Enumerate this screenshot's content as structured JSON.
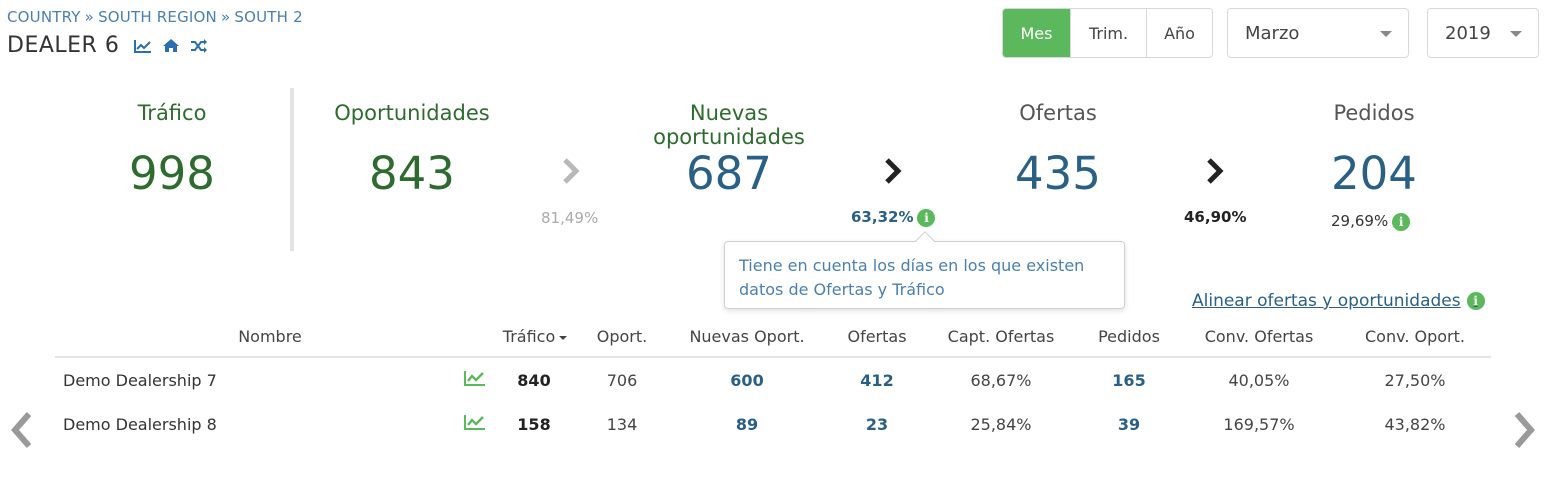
{
  "breadcrumb": [
    "COUNTRY",
    "SOUTH REGION",
    "SOUTH 2"
  ],
  "breadcrumb_separator": "»",
  "page_title": "DEALER 6",
  "title_icons": [
    "line-chart-icon",
    "home-icon",
    "shuffle-icon"
  ],
  "period": {
    "options": [
      "Mes",
      "Trim.",
      "Año"
    ],
    "selected": "Mes"
  },
  "month_select": {
    "value": "Marzo"
  },
  "year_select": {
    "value": "2019"
  },
  "metrics": {
    "trafico": {
      "label": "Tráfico",
      "value": "998"
    },
    "oportunidades": {
      "label": "Oportunidades",
      "value": "843"
    },
    "nuevas": {
      "label": "Nuevas oportunidades",
      "value": "687"
    },
    "ofertas": {
      "label": "Ofertas",
      "value": "435"
    },
    "pedidos": {
      "label": "Pedidos",
      "value": "204"
    }
  },
  "conversions": {
    "oport_to_nuevas": "81,49%",
    "nuevas_to_ofertas": "63,32%",
    "ofertas_to_pedidos": "46,90%",
    "pedidos_pct": "29,69%"
  },
  "tooltip": {
    "text": "Tiene en cuenta los días en los que existen datos de Ofertas y Tráfico"
  },
  "align_link": "Alinear ofertas y oportunidades",
  "table": {
    "headers": {
      "nombre": "Nombre",
      "trafico": "Tráfico",
      "oport": "Oport.",
      "nuevas": "Nuevas Oport.",
      "ofertas": "Ofertas",
      "capt": "Capt. Ofertas",
      "pedidos": "Pedidos",
      "conv_ofertas": "Conv. Ofertas",
      "conv_oport": "Conv. Oport."
    },
    "rows": [
      {
        "nombre": "Demo Dealership 7",
        "trafico": "840",
        "oport": "706",
        "nuevas": "600",
        "ofertas": "412",
        "capt": "68,67%",
        "pedidos": "165",
        "conv_ofertas": "40,05%",
        "conv_oport": "27,50%"
      },
      {
        "nombre": "Demo Dealership 8",
        "trafico": "158",
        "oport": "134",
        "nuevas": "89",
        "ofertas": "23",
        "capt": "25,84%",
        "pedidos": "39",
        "conv_ofertas": "169,57%",
        "conv_oport": "43,82%"
      }
    ]
  },
  "colors": {
    "accent_green": "#5cb85c",
    "metric_green": "#2e6b2e",
    "metric_blue": "#2a5f86",
    "link_blue": "#4a7fb0"
  }
}
